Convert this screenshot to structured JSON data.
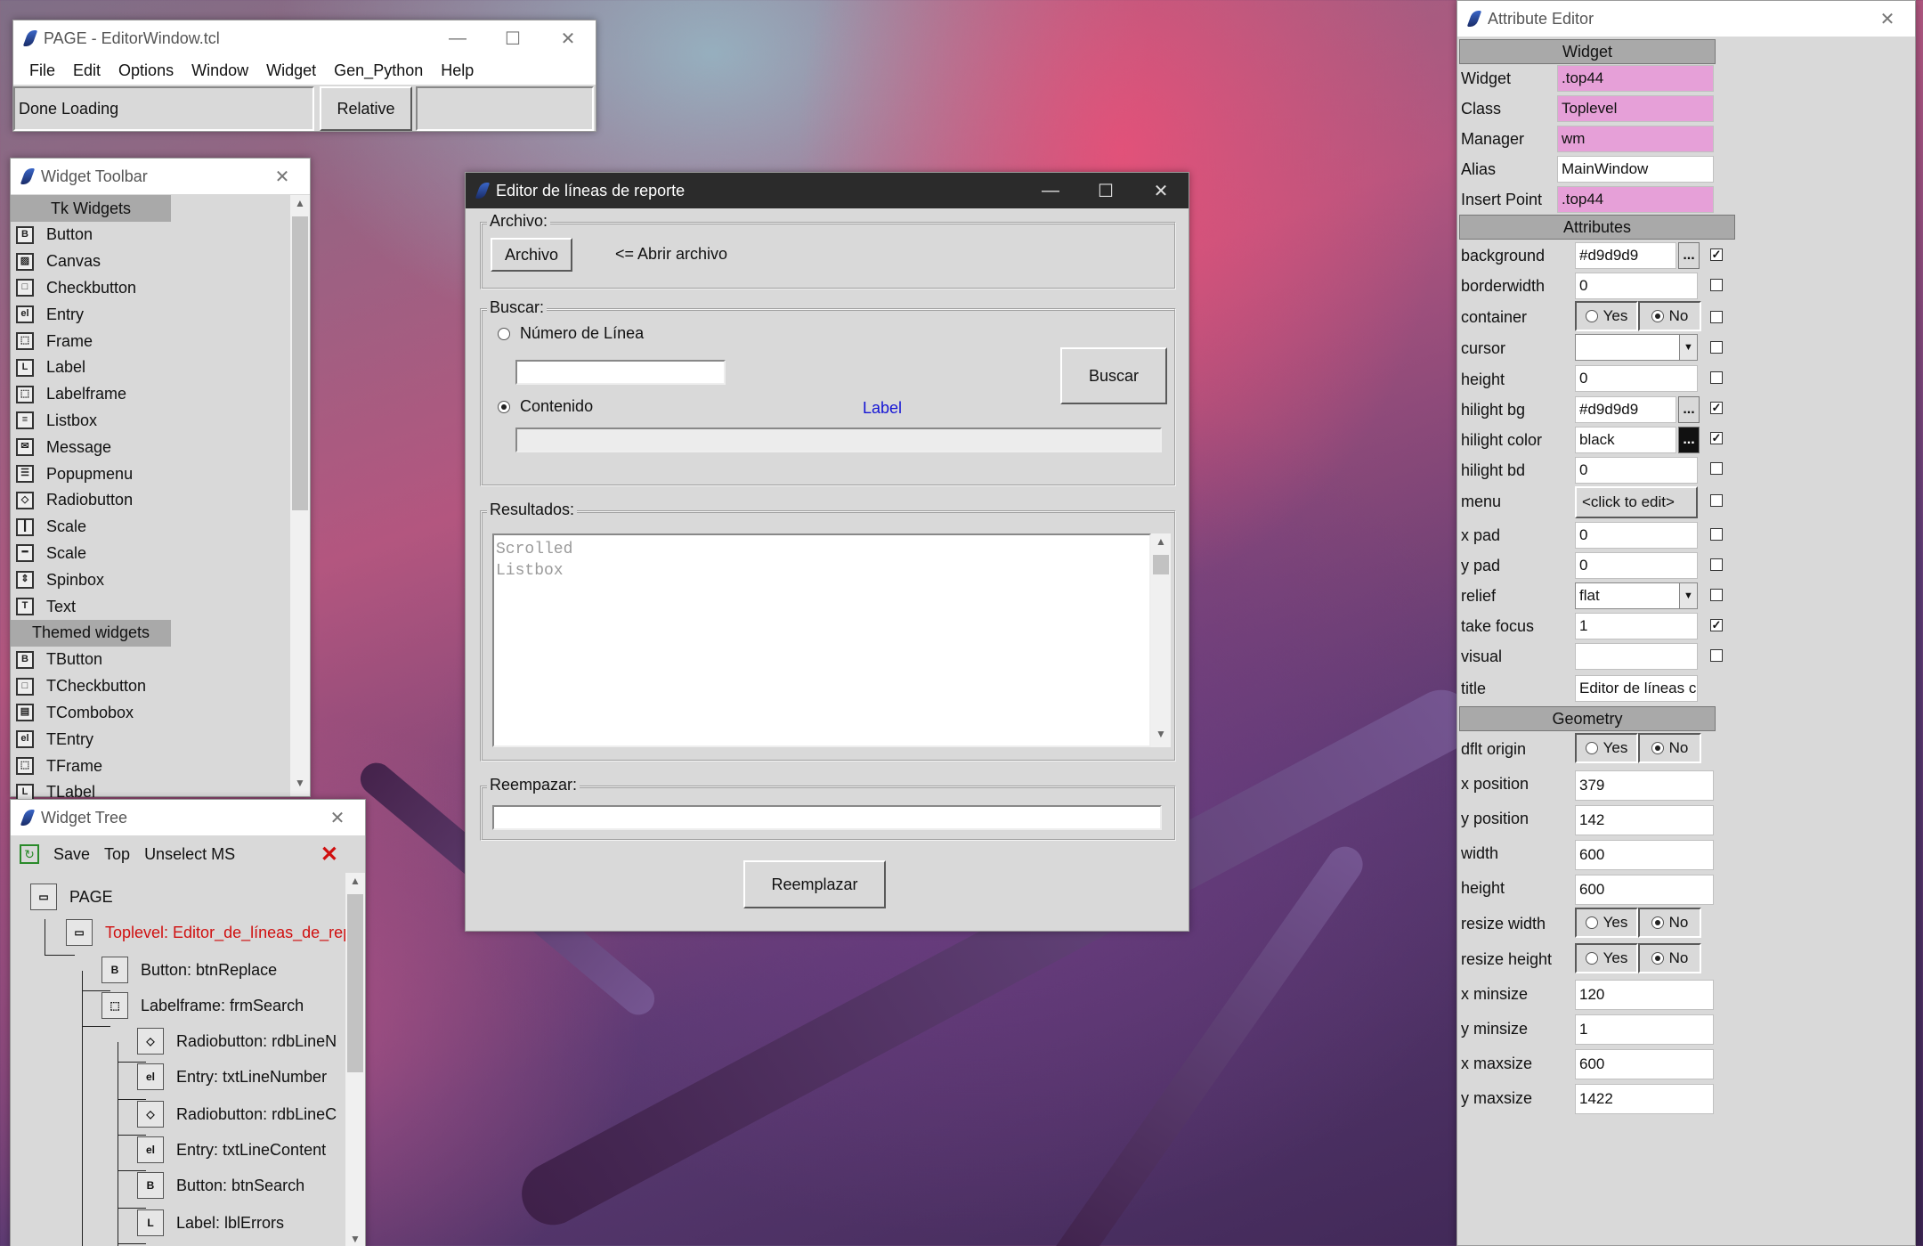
{
  "page_window": {
    "title": "PAGE - EditorWindow.tcl",
    "menu": [
      "File",
      "Edit",
      "Options",
      "Window",
      "Widget",
      "Gen_Python",
      "Help"
    ],
    "status": "Done Loading",
    "mode_button": "Relative"
  },
  "toolbar": {
    "title": "Widget Toolbar",
    "tk_header": "Tk Widgets",
    "tk_items": [
      {
        "label": "Button",
        "icon": "button-icon"
      },
      {
        "label": "Canvas",
        "icon": "canvas-icon"
      },
      {
        "label": "Checkbutton",
        "icon": "checkbutton-icon"
      },
      {
        "label": "Entry",
        "icon": "entry-icon"
      },
      {
        "label": "Frame",
        "icon": "frame-icon"
      },
      {
        "label": "Label",
        "icon": "label-icon"
      },
      {
        "label": "Labelframe",
        "icon": "labelframe-icon"
      },
      {
        "label": "Listbox",
        "icon": "listbox-icon"
      },
      {
        "label": "Message",
        "icon": "message-icon"
      },
      {
        "label": "Popupmenu",
        "icon": "popupmenu-icon"
      },
      {
        "label": "Radiobutton",
        "icon": "radiobutton-icon"
      },
      {
        "label": "Scale",
        "icon": "scale-icon"
      },
      {
        "label": "Scale",
        "icon": "scale-horizontal-icon"
      },
      {
        "label": "Spinbox",
        "icon": "spinbox-icon"
      },
      {
        "label": "Text",
        "icon": "text-icon"
      }
    ],
    "themed_header": "Themed widgets",
    "themed_items": [
      {
        "label": "TButton",
        "icon": "button-icon"
      },
      {
        "label": "TCheckbutton",
        "icon": "checkbutton-icon"
      },
      {
        "label": "TCombobox",
        "icon": "combobox-icon"
      },
      {
        "label": "TEntry",
        "icon": "entry-icon"
      },
      {
        "label": "TFrame",
        "icon": "frame-icon"
      },
      {
        "label": "TLabel",
        "icon": "label-icon"
      }
    ]
  },
  "tree": {
    "title": "Widget Tree",
    "save": "Save",
    "top": "Top",
    "unselect": "Unselect MS",
    "nodes": [
      "PAGE",
      "Toplevel: Editor_de_líneas_de_rep",
      "Button: btnReplace",
      "Labelframe: frmSearch",
      "Radiobutton: rdbLineN",
      "Entry: txtLineNumber",
      "Radiobutton: rdbLineC",
      "Entry: txtLineContent",
      "Button: btnSearch",
      "Label: lblErrors"
    ]
  },
  "editor": {
    "title": "Editor de líneas de reporte",
    "archivo_frame": "Archivo:",
    "archivo_button": "Archivo",
    "abrir_label": "<= Abrir archivo",
    "buscar_frame": "Buscar:",
    "radio_numero": "Número de Línea",
    "radio_contenido": "Contenido",
    "label_placeholder": "Label",
    "buscar_button": "Buscar",
    "resultados_frame": "Resultados:",
    "listbox_placeholder_1": "Scrolled",
    "listbox_placeholder_2": "Listbox",
    "reemplazar_frame": "Reempazar:",
    "reemplazar_button": "Reemplazar",
    "colors": {
      "label_blue": "#1515d5",
      "title_dark": "#2b2b2b"
    }
  },
  "attr": {
    "title": "Attribute Editor",
    "widget_header": "Widget",
    "widget_rows": [
      {
        "label": "Widget",
        "value": ".top44"
      },
      {
        "label": "Class",
        "value": "Toplevel"
      },
      {
        "label": "Manager",
        "value": "wm"
      },
      {
        "label": "Alias",
        "value": "MainWindow"
      },
      {
        "label": "Insert Point",
        "value": ".top44"
      }
    ],
    "attributes_header": "Attributes",
    "background_label": "background",
    "background_value": "#d9d9d9",
    "borderwidth_label": "borderwidth",
    "borderwidth_value": "0",
    "container_label": "container",
    "cursor_label": "cursor",
    "cursor_value": "",
    "height_label": "height",
    "height_value": "0",
    "hilightbg_label": "hilight bg",
    "hilightbg_value": "#d9d9d9",
    "hilightcolor_label": "hilight color",
    "hilightcolor_value": "black",
    "hilightbd_label": "hilight bd",
    "hilightbd_value": "0",
    "menu_label": "menu",
    "menu_value": "<click to edit>",
    "xpad_label": "x pad",
    "xpad_value": "0",
    "ypad_label": "y pad",
    "ypad_value": "0",
    "relief_label": "relief",
    "relief_value": "flat",
    "takefocus_label": "take focus",
    "takefocus_value": "1",
    "visual_label": "visual",
    "visual_value": "",
    "title_label": "title",
    "title_value": "Editor de líneas c",
    "geometry_header": "Geometry",
    "dflt_label": "dflt origin",
    "xpos_label": "x position",
    "xpos_value": "379",
    "ypos_label": "y position",
    "ypos_value": "142",
    "width_label": "width",
    "width_value": "600",
    "gheight_label": "height",
    "gheight_value": "600",
    "rw_label": "resize width",
    "rh_label": "resize height",
    "xmin_label": "x minsize",
    "xmin_value": "120",
    "ymin_label": "y minsize",
    "ymin_value": "1",
    "xmax_label": "x maxsize",
    "xmax_value": "600",
    "ymax_label": "y maxsize",
    "ymax_value": "1422",
    "yes": "Yes",
    "no": "No",
    "ellipsis": "...",
    "check_mark": "✓",
    "colors": {
      "pink": "#e6a0d8",
      "section_gray": "#a9a9a9"
    }
  }
}
